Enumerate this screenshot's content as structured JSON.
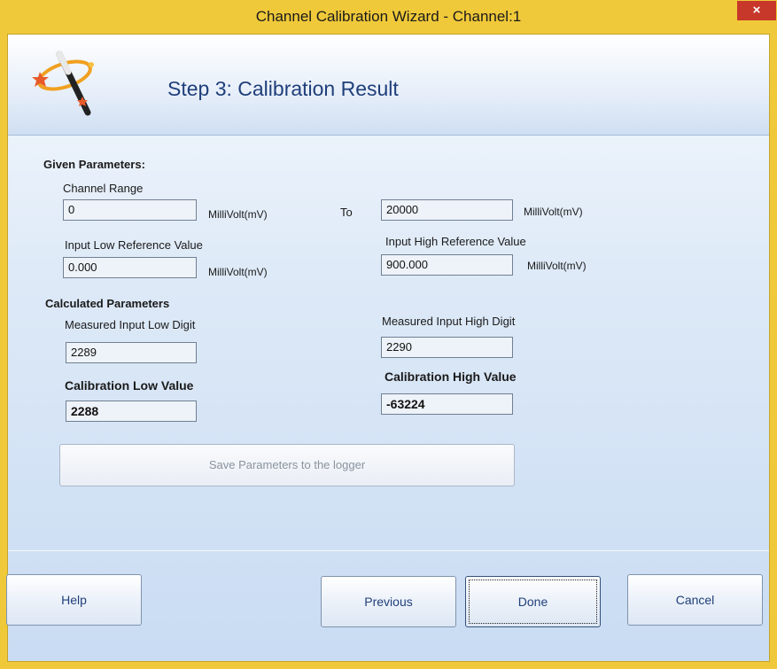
{
  "window": {
    "title": "Channel Calibration Wizard - Channel:1",
    "close_glyph": "×",
    "accent_color": "#f0c93a",
    "close_color": "#c7382b"
  },
  "header": {
    "icon": "magic-wand-icon",
    "step_title": "Step 3: Calibration Result"
  },
  "given": {
    "section_label": "Given Parameters:",
    "channel_range_label": "Channel Range",
    "range_low_value": "0",
    "range_low_unit": "MilliVolt(mV)",
    "to_label": "To",
    "range_high_value": "20000",
    "range_high_unit": "MilliVolt(mV)",
    "input_low_ref_label": "Input Low Reference Value",
    "input_low_ref_value": "0.000",
    "input_low_ref_unit": "MilliVolt(mV)",
    "input_high_ref_label": "Input High Reference Value",
    "input_high_ref_value": "900.000",
    "input_high_ref_unit": "MilliVolt(mV)"
  },
  "calculated": {
    "section_label": "Calculated Parameters",
    "measured_low_label": "Measured Input Low  Digit",
    "measured_low_value": "2289",
    "measured_high_label": "Measured Input High Digit",
    "measured_high_value": "2290",
    "cal_low_label": "Calibration Low Value",
    "cal_low_value": "2288",
    "cal_high_label": "Calibration High Value",
    "cal_high_value": "-63224"
  },
  "actions": {
    "save_label": "Save Parameters to the logger",
    "help_label": "Help",
    "previous_label": "Previous",
    "done_label": "Done",
    "cancel_label": "Cancel"
  }
}
